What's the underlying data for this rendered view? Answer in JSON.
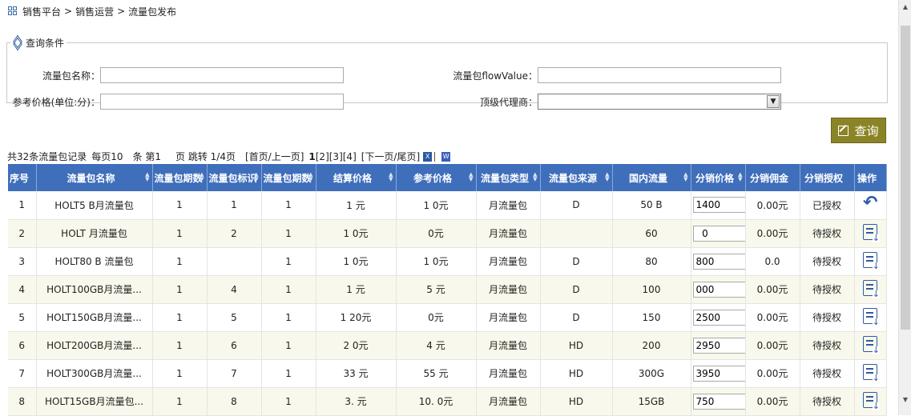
{
  "breadcrumb": {
    "items": [
      "销售平台",
      "销售运营",
      "流量包发布"
    ],
    "separator": ">"
  },
  "query": {
    "legend": "查询条件",
    "name_label": "流量包名称：",
    "flow_label": "流量包flowValue：",
    "price_label": "参考价格(单位:分)：",
    "agent_label": "顶级代理商：",
    "agent_value": "",
    "button_label": "查询"
  },
  "pager": {
    "total": "共32条流量包记录",
    "per_page": "每页10",
    "item_unit": "条 第1",
    "page_jump": "页 跳转 1/4页",
    "first_prev": "[首页/上一页]",
    "page_current": "1",
    "page_links": "[2][3][4]",
    "next_last": "[下一页/尾页]",
    "excel_icon": "X",
    "word_icon": "W"
  },
  "table": {
    "headers": [
      "序号",
      "流量包名称",
      "流量包期数",
      "流量包标识",
      "流量包期数",
      "结算价格",
      "参考价格",
      "流量包类型",
      "流量包来源",
      "国内流量",
      "分销价格",
      "分销佣金",
      "分销授权",
      "操作"
    ],
    "rows": [
      {
        "no": "1",
        "name": "HOLT5 B月流量包",
        "periods": "1",
        "flag": "1",
        "periods2": "1",
        "settle": "1  元",
        "ref": "1  0元",
        "type": "月流量包",
        "source": "  D",
        "domestic": "50  B",
        "price": "1400",
        "commission": "0.00元",
        "auth": "已授权",
        "action": "revoke"
      },
      {
        "no": "2",
        "name": "HOLT  月流量包",
        "periods": "1",
        "flag": "2",
        "periods2": "1",
        "settle": "1  0元",
        "ref": "  0元",
        "type": "月流量包",
        "source": "",
        "domestic": "60",
        "price": "  0",
        "commission": "0.00元",
        "auth": "待授权",
        "action": "pending"
      },
      {
        "no": "3",
        "name": "HOLT80  B 流量包",
        "periods": "1",
        "flag": "",
        "periods2": "1",
        "settle": "1  0元",
        "ref": "1  0元",
        "type": "月流量包",
        "source": "  D",
        "domestic": "80",
        "price": "800",
        "commission": "0.0",
        "auth": "待授权",
        "action": "pending"
      },
      {
        "no": "4",
        "name": "HOLT100GB月流量...",
        "periods": "1",
        "flag": "4",
        "periods2": "1",
        "settle": "1  元",
        "ref": "5  元",
        "type": "月流量包",
        "source": "  D",
        "domestic": "100",
        "price": "000",
        "commission": "0.00元",
        "auth": "待授权",
        "action": "pending"
      },
      {
        "no": "5",
        "name": "HOLT150GB月流量...",
        "periods": "1",
        "flag": "5",
        "periods2": "1",
        "settle": "1  20元",
        "ref": "  0元",
        "type": "月流量包",
        "source": "  D",
        "domestic": "150",
        "price": "2500",
        "commission": "0.00元",
        "auth": "待授权",
        "action": "pending"
      },
      {
        "no": "6",
        "name": "HOLT200GB月流量...",
        "periods": "1",
        "flag": "6",
        "periods2": "1",
        "settle": "2  0元",
        "ref": "4  元",
        "type": "月流量包",
        "source": "  HD",
        "domestic": "200",
        "price": "2950",
        "commission": "0.00元",
        "auth": "待授权",
        "action": "pending"
      },
      {
        "no": "7",
        "name": "HOLT300GB月流量...",
        "periods": "1",
        "flag": "7",
        "periods2": "1",
        "settle": "33  元",
        "ref": "55  元",
        "type": "月流量包",
        "source": "  HD",
        "domestic": "300G",
        "price": "3950",
        "commission": "0.00元",
        "auth": "待授权",
        "action": "pending"
      },
      {
        "no": "8",
        "name": "HOLT15GB月流量包...",
        "periods": "1",
        "flag": "8",
        "periods2": "1",
        "settle": "3.  元",
        "ref": "10.  0元",
        "type": "月流量包",
        "source": "  HD",
        "domestic": "15GB",
        "price": "750",
        "commission": "0.00元",
        "auth": "待授权",
        "action": "pending"
      }
    ]
  },
  "colors": {
    "header_bg": "#3f6ebb",
    "button_bg": "#8b8426",
    "row_alt": "#f8f9ec"
  }
}
